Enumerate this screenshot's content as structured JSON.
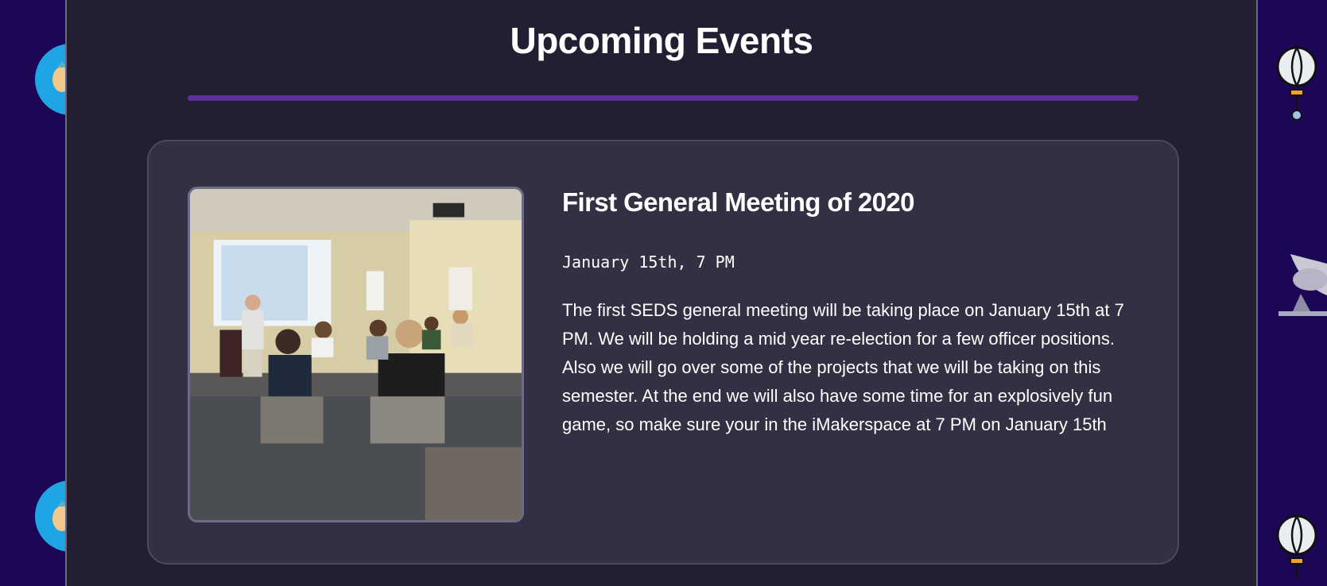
{
  "section": {
    "title": "Upcoming Events"
  },
  "event": {
    "title": "First General Meeting of 2020",
    "date": "January 15th, 7 PM",
    "description": "The first SEDS general meeting will be taking place on January 15th at 7 PM. We will be holding a mid year re-election for a few officer positions. Also we will go over some of the projects that we will be taking on this semester. At the end we will also have some time for an explosively fun game, so make sure your in the iMakerspace at 7 PM on January 15th",
    "image": "meeting-photo"
  },
  "background": {
    "icons": [
      "astronaut-icon",
      "astronaut-icon",
      "hot-air-balloon-icon",
      "satellite-dish-icon",
      "hot-air-balloon-icon"
    ]
  },
  "colors": {
    "page_bg": "#1c0655",
    "panel_bg": "#211f31",
    "card_bg": "#323042",
    "accent": "#5f2f98"
  }
}
